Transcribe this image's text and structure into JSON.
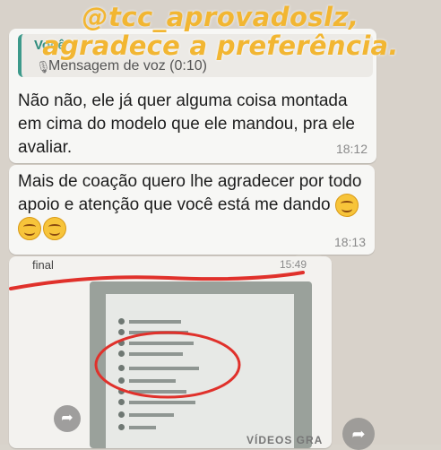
{
  "watermark": {
    "line1": "@tcc_aprovadoslz,",
    "line2": "agradece a preferência."
  },
  "message1": {
    "quote_author": "Você",
    "quote_icon": "mic-icon",
    "quote_text": "Mensagem de voz (0:10)",
    "text": "Não não, ele já quer alguma coisa montada em cima do modelo que ele mandou, pra ele avaliar.",
    "time": "18:12"
  },
  "message2": {
    "text": "Mais de coação quero lhe agradecer por todo apoio e atenção que você está me dando",
    "emojis": [
      "smiling-face-icon",
      "smiling-face-icon",
      "smiling-face-icon"
    ],
    "time": "18:13"
  },
  "image_message": {
    "title": "final",
    "time": "15:49",
    "footer_label": "VÍDEOS GRA",
    "highlight_color": "#e0312b"
  },
  "icons": {
    "share_left": "forward-icon",
    "share_right": "forward-icon"
  },
  "colors": {
    "watermark": "#f2b632",
    "quote_accent": "#3d9a8b",
    "bubble": "#f7f7f5"
  }
}
